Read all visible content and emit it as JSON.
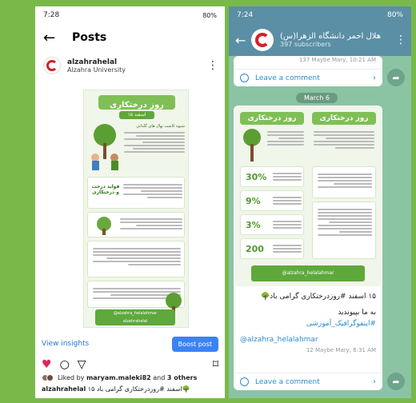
{
  "instagram": {
    "status": {
      "time": "7:28",
      "right": "80%"
    },
    "nav": {
      "back": "←",
      "title": "Posts"
    },
    "account": {
      "username": "alzahrahelal",
      "subtitle": "Alzahra University"
    },
    "post": {
      "title": "روز درختکاری",
      "date": "۱۵ اسفند",
      "section1": "شیوه کاشت نهال های گلدانی",
      "benefits_title": "فواید درخت و درختکاری",
      "footer_handle1": "@alzahra_helalahmar",
      "footer_handle2": "alzahrahelal"
    },
    "insights": {
      "view": "View insights",
      "boost": "Boost post"
    },
    "likes": {
      "prefix": "Liked by",
      "user": "maryam.maleki82",
      "mid": "and",
      "others": "3 others"
    },
    "caption": {
      "user": "alzahrahelal",
      "text": "۱۵ اسفند #روزدرختکاری گرامی باد🌳"
    }
  },
  "telegram": {
    "status": {
      "time": "7:24",
      "right": "80%"
    },
    "header": {
      "back": "←",
      "name": "هلال احمر دانشگاه الزهرا(س)",
      "subs": "397 subscribers"
    },
    "prev_meta": "137  Maybe  Mary, 10:21 AM",
    "comment1": "Leave a comment",
    "date_chip": "March 6",
    "post": {
      "title_a": "روز درختکاری",
      "title_b": "روز درختکاری",
      "stat1": "30%",
      "stat2": "9%",
      "stat3": "3%",
      "stat4": "200",
      "footer_handle1": "@alzahra_helalahmar"
    },
    "caption_line1": "۱۵ اسفند #روزدرختکاری گرامی باد🌳",
    "caption_line2": "به ما بپیوندید",
    "caption_line3": "#اینفوگرافیک_آموزشی",
    "mention": "@alzahra_helalahmar",
    "meta2": "12  Maybe  Mary, 6:31 AM",
    "comment2": "Leave a comment"
  },
  "colors": {
    "accent_green": "#79b94a",
    "tg_header": "#5b8fa5",
    "tg_link": "#2a8bd1",
    "ig_blue": "#3b82f6"
  }
}
